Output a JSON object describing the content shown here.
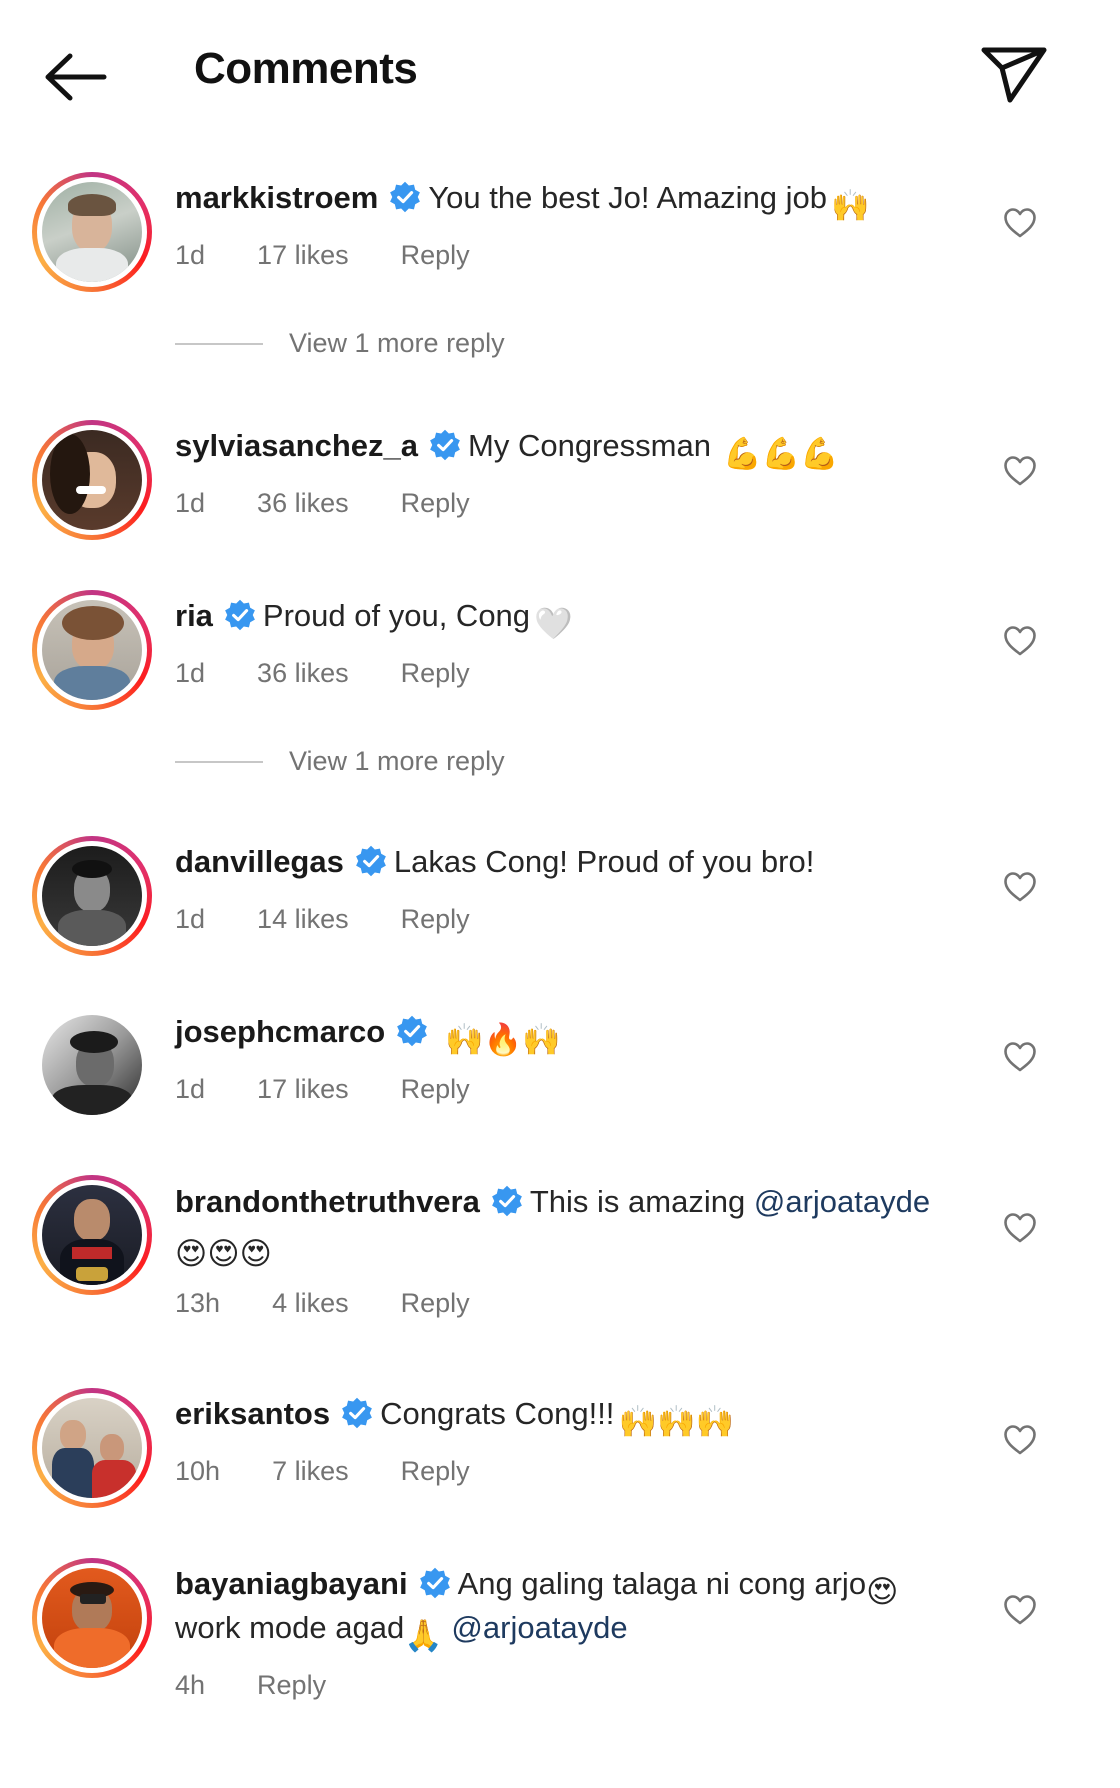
{
  "header": {
    "title": "Comments",
    "back_icon": "arrow-left-icon",
    "send_icon": "paper-plane-icon"
  },
  "comments": [
    {
      "username": "markkistroem",
      "text": "You the best Jo! Amazing job",
      "emoji": "🙌",
      "time": "1d",
      "likes": "17 likes",
      "reply": "Reply",
      "more_replies": "View 1 more reply"
    },
    {
      "username": "sylviasanchez_a",
      "text": "My Congressman",
      "emoji": "💪💪💪",
      "time": "1d",
      "likes": "36 likes",
      "reply": "Reply"
    },
    {
      "username": "ria",
      "text": "Proud of you, Cong",
      "emoji": "🤍",
      "time": "1d",
      "likes": "36 likes",
      "reply": "Reply",
      "more_replies": "View 1 more reply"
    },
    {
      "username": "danvillegas",
      "text": "Lakas Cong! Proud of you bro!",
      "time": "1d",
      "likes": "14 likes",
      "reply": "Reply"
    },
    {
      "username": "josephcmarco",
      "text": "",
      "emoji": "🙌🔥🙌",
      "time": "1d",
      "likes": "17 likes",
      "reply": "Reply"
    },
    {
      "username": "brandonthetruthvera",
      "text": "This is amazing",
      "mention": "@arjoatayde",
      "emoji_line2": "😍😍😍",
      "time": "13h",
      "likes": "4 likes",
      "reply": "Reply"
    },
    {
      "username": "eriksantos",
      "text": "Congrats Cong!!!",
      "emoji": "🙌🙌🙌",
      "time": "10h",
      "likes": "7 likes",
      "reply": "Reply"
    },
    {
      "username": "bayaniagbayani",
      "text": "Ang galing talaga ni cong arjo",
      "emoji": "😍",
      "text_line2": "work mode agad",
      "emoji_line2": "🙏",
      "mention": "@arjoatayde",
      "time": "4h",
      "reply": "Reply"
    }
  ],
  "colors": {
    "verified": "#3897f0",
    "mention": "#1e3a5f",
    "meta": "#737373"
  }
}
